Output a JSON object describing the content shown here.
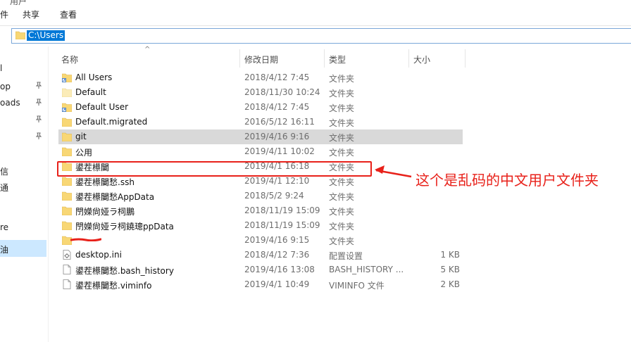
{
  "ribbon": {
    "title_fragment": "用户",
    "tabs": [
      {
        "label": "文件"
      },
      {
        "label": "共享"
      },
      {
        "label": "查看"
      }
    ]
  },
  "address": {
    "path": "C:\\Users"
  },
  "nav": {
    "items": [
      {
        "label": "l"
      },
      {
        "label": "op"
      },
      {
        "label": "oads"
      },
      {
        "label": "信"
      },
      {
        "label": "通"
      },
      {
        "label": "re"
      },
      {
        "label": "油"
      }
    ]
  },
  "columns": {
    "name": "名称",
    "date": "修改日期",
    "type": "类型",
    "size": "大小"
  },
  "files": [
    {
      "name": "All Users",
      "date": "2018/4/12 7:45",
      "type": "文件夹",
      "size": "",
      "icon": "folder-shortcut-icon"
    },
    {
      "name": "Default",
      "date": "2018/11/30 10:24",
      "type": "文件夹",
      "size": "",
      "icon": "folder-hidden-icon"
    },
    {
      "name": "Default User",
      "date": "2018/4/12 7:45",
      "type": "文件夹",
      "size": "",
      "icon": "folder-shortcut-icon"
    },
    {
      "name": "Default.migrated",
      "date": "2016/5/12 16:11",
      "type": "文件夹",
      "size": "",
      "icon": "folder-icon"
    },
    {
      "name": "git",
      "date": "2019/4/16 9:16",
      "type": "文件夹",
      "size": "",
      "icon": "folder-icon"
    },
    {
      "name": "公用",
      "date": "2019/4/11 10:02",
      "type": "文件夹",
      "size": "",
      "icon": "folder-icon"
    },
    {
      "name": "鍙茬櫒闄",
      "date": "2019/4/1 16:18",
      "type": "文件夹",
      "size": "",
      "icon": "folder-icon"
    },
    {
      "name": "鍙茬櫒闄愁.ssh",
      "date": "2019/4/1 12:10",
      "type": "文件夹",
      "size": "",
      "icon": "folder-icon"
    },
    {
      "name": "鍙茬櫒闄愁AppData",
      "date": "2018/5/2 9:24",
      "type": "文件夹",
      "size": "",
      "icon": "folder-icon"
    },
    {
      "name": "閅嬫尙娅ラ柌鵬",
      "date": "2018/11/19 15:09",
      "type": "文件夹",
      "size": "",
      "icon": "folder-icon"
    },
    {
      "name": "閅嬫尙娅ラ柌鐃璁ppData",
      "date": "2018/11/19 15:09",
      "type": "文件夹",
      "size": "",
      "icon": "folder-icon"
    },
    {
      "name": "",
      "date": "2019/4/16 9:15",
      "type": "文件夹",
      "size": "",
      "icon": "folder-icon"
    },
    {
      "name": "desktop.ini",
      "date": "2018/4/12 7:36",
      "type": "配置设置",
      "size": "1 KB",
      "icon": "settings-file-icon"
    },
    {
      "name": "鍙茬櫒闄愁.bash_history",
      "date": "2019/4/16 13:08",
      "type": "BASH_HISTORY ...",
      "size": "5 KB",
      "icon": "file-icon"
    },
    {
      "name": "鍙茬櫒闄愁.viminfo",
      "date": "2019/4/1 10:49",
      "type": "VIMINFO 文件",
      "size": "2 KB",
      "icon": "file-icon"
    }
  ],
  "annotation": {
    "text": "这个是乱码的中文用户文件夹",
    "color": "#e8211a"
  },
  "colors": {
    "accent": "#0078d7",
    "folder": "#f8d775",
    "annotation_red": "#e8211a",
    "selection": "#cce8ff"
  }
}
